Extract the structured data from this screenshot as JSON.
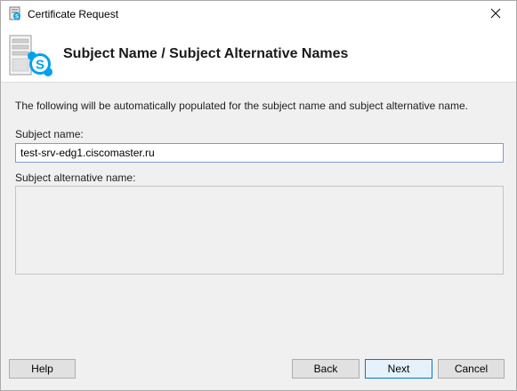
{
  "window": {
    "title": "Certificate Request"
  },
  "header": {
    "title": "Subject Name / Subject Alternative Names",
    "icon": "skype-server-certificate-icon"
  },
  "main": {
    "description": "The following will be automatically populated for the subject name and subject alternative name.",
    "subject_name_label": "Subject name:",
    "subject_name_value": "test-srv-edg1.ciscomaster.ru",
    "alt_name_label": "Subject alternative name:"
  },
  "buttons": {
    "help": "Help",
    "back": "Back",
    "next": "Next",
    "cancel": "Cancel"
  },
  "colors": {
    "accent": "#0078d7",
    "skype_blue": "#00a2ed"
  }
}
